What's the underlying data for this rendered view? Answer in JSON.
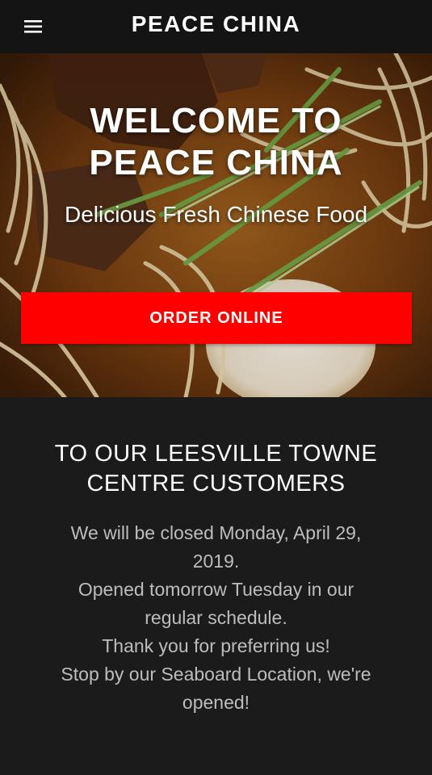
{
  "header": {
    "brand": "PEACE CHINA",
    "menu_icon": "hamburger-menu-icon"
  },
  "hero": {
    "title_line1": "WELCOME TO",
    "title_line2": "PEACE CHINA",
    "subtitle": "Delicious Fresh Chinese Food",
    "order_button_label": "ORDER ONLINE",
    "order_button_color": "#ff0000"
  },
  "notice": {
    "title_line1": "TO OUR LEESVILLE TOWNE",
    "title_line2": "CENTRE CUSTOMERS",
    "lines": [
      "We will be closed Monday, April 29,",
      "2019.",
      "Opened tomorrow Tuesday in our",
      "regular schedule.",
      "Thank you for preferring us!",
      "Stop by our Seaboard Location, we're",
      "opened!"
    ]
  },
  "colors": {
    "background": "#1b1b1b",
    "header_background": "#141414",
    "accent": "#ff0000",
    "body_text": "#bdbdbd"
  }
}
